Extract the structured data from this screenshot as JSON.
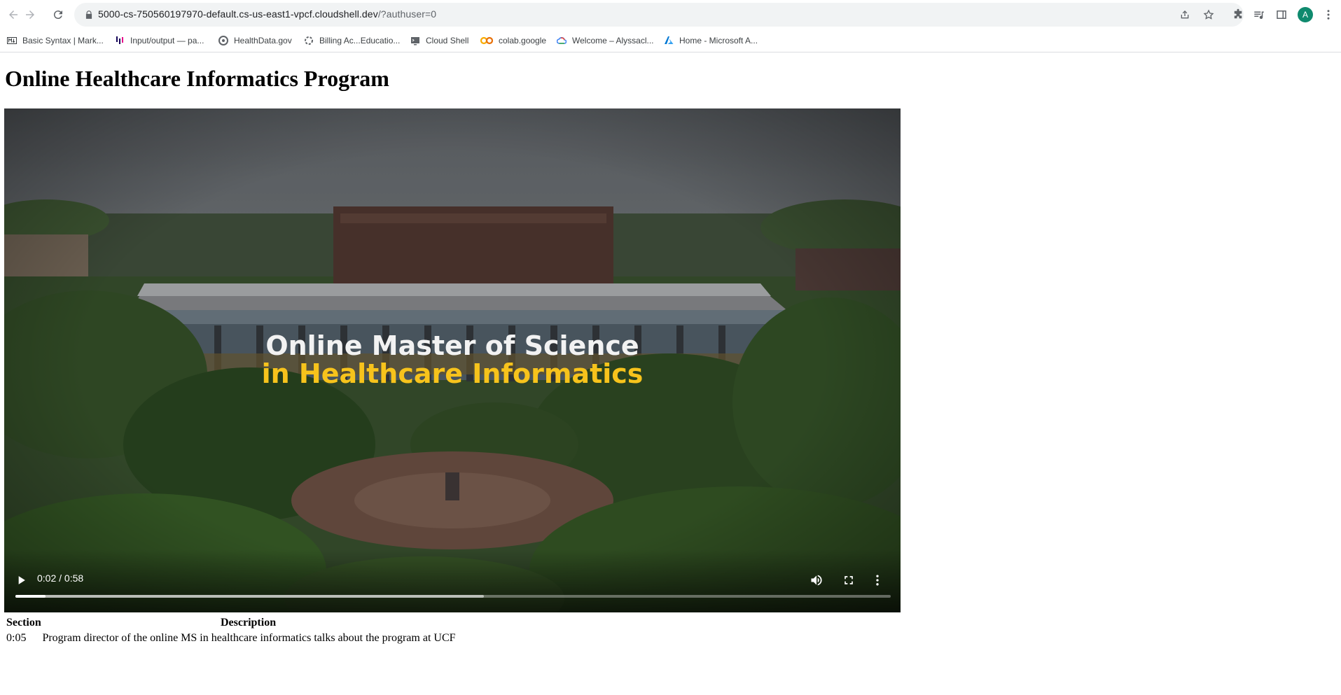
{
  "browser": {
    "url_host": "5000-cs-750560197970-default.cs-us-east1-vpcf.cloudshell.dev",
    "url_path": "/?authuser=0",
    "profile_initial": "A",
    "icons": [
      "back-icon",
      "forward-icon",
      "reload-icon",
      "lock-icon",
      "share-icon",
      "star-icon",
      "extensions-icon",
      "media-control-icon",
      "side-panel-icon",
      "menu-icon"
    ]
  },
  "bookmarks": [
    {
      "label": "Basic Syntax | Mark...",
      "icon": "markdown-icon"
    },
    {
      "label": "Input/output — pa...",
      "icon": "pandas-icon"
    },
    {
      "label": "HealthData.gov",
      "icon": "healthdata-icon"
    },
    {
      "label": "Billing Ac...Educatio...",
      "icon": "billing-icon"
    },
    {
      "label": "Cloud Shell",
      "icon": "cloud-shell-icon"
    },
    {
      "label": "colab.google",
      "icon": "colab-icon"
    },
    {
      "label": "Welcome – Alyssacl...",
      "icon": "google-cloud-icon"
    },
    {
      "label": "Home - Microsoft A...",
      "icon": "azure-icon"
    }
  ],
  "page": {
    "title": "Online Healthcare Informatics Program"
  },
  "video": {
    "overlay_line1": "Online Master of Science",
    "overlay_line2": "in Healthcare Informatics",
    "time": "0:02 / 0:58",
    "played_fraction": 0.034,
    "buffered_fraction": 0.535,
    "colors": {
      "overlay_highlight": "#f7c31c"
    }
  },
  "sections_table": {
    "headers": {
      "section": "Section",
      "description": "Description"
    },
    "rows": [
      {
        "section": "0:05",
        "description": "Program director of the online MS in healthcare informatics talks about the program at UCF"
      }
    ]
  }
}
